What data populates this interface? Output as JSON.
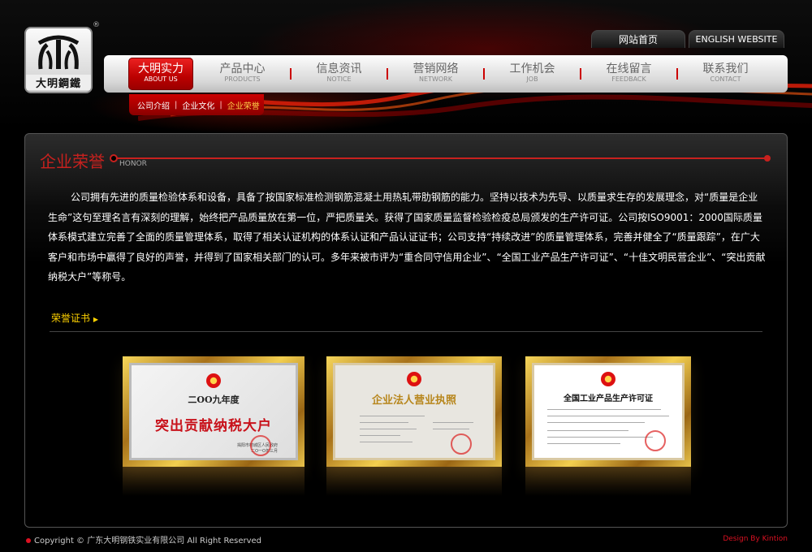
{
  "logo": {
    "text": "大明鋼鐵",
    "registered": "®"
  },
  "toplinks": {
    "home": "网站首页",
    "english": "ENGLISH WEBSITE"
  },
  "nav": [
    {
      "cn": "大明实力",
      "en": "ABOUT US"
    },
    {
      "cn": "产品中心",
      "en": "PRODUCTS"
    },
    {
      "cn": "信息资讯",
      "en": "NOTICE"
    },
    {
      "cn": "营销网络",
      "en": "NETWORK"
    },
    {
      "cn": "工作机会",
      "en": "JOB"
    },
    {
      "cn": "在线留言",
      "en": "FEEDBACK"
    },
    {
      "cn": "联系我们",
      "en": "CONTACT"
    }
  ],
  "subnav": [
    "公司介绍",
    "企业文化",
    "企业荣誉"
  ],
  "section": {
    "title": "企业荣誉",
    "subtitle": "HONOR",
    "text": "公司拥有先进的质量检验体系和设备，具备了按国家标准检测钢筋混凝土用热轧带肋钢筋的能力。坚持以技术为先导、以质量求生存的发展理念，对“质量是企业生命”这句至理名言有深刻的理解，始终把产品质量放在第一位，严把质量关。获得了国家质量监督检验检疫总局颁发的生产许可证。公司按ISO9001：2000国际质量体系模式建立完善了全面的质量管理体系，取得了相关认证机构的体系认证和产品认证证书；公司支持“持续改进”的质量管理体系，完善并健全了“质量跟踪”，在广大客户和市场中赢得了良好的声誉，并得到了国家相关部门的认可。多年来被市评为“重合同守信用企业”、“全国工业产品生产许可证”、“十佳文明民营企业”、“突出贡献纳税大户”等称号。",
    "honor_title": "荣誉证书"
  },
  "certificates": [
    {
      "year": "二OO九年度",
      "title": "突出贡献纳税大户",
      "org": "揭阳市榕城区人民政府",
      "date": "二O一O年三月"
    },
    {
      "title": "企业法人营业执照"
    },
    {
      "title": "全国工业产品生产许可证"
    }
  ],
  "footer": {
    "copyright": "Copyright © 广东大明钢铁实业有限公司 All Right Reserved",
    "design": "Design By Kintion"
  }
}
